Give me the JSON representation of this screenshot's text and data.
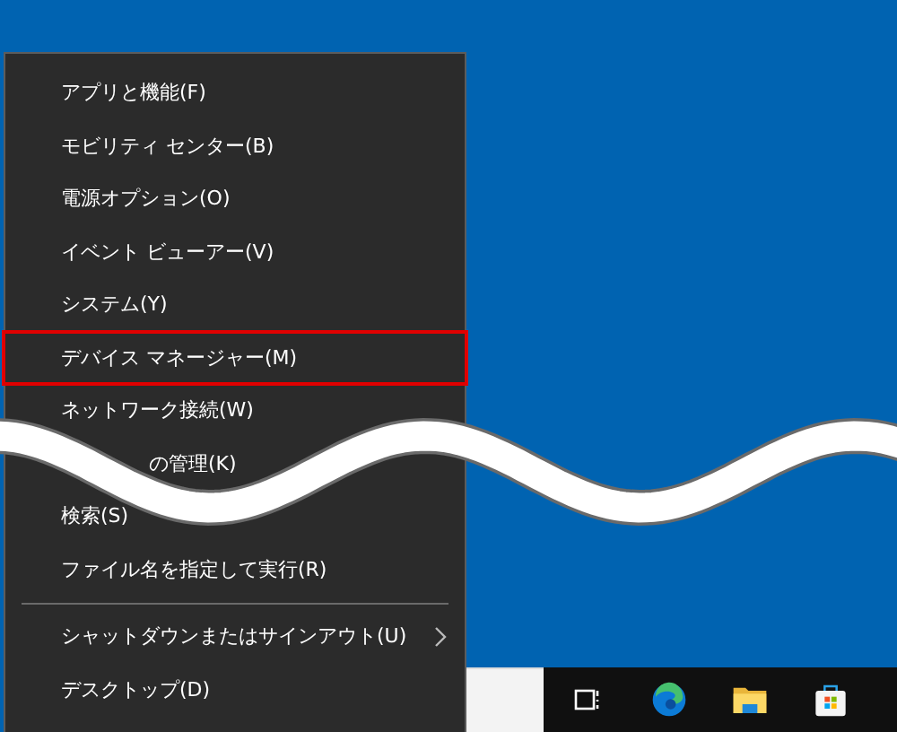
{
  "menu": {
    "items": [
      {
        "kind": "item",
        "label": "アプリと機能(F)",
        "selected": false
      },
      {
        "kind": "item",
        "label": "モビリティ センター(B)",
        "selected": false
      },
      {
        "kind": "item",
        "label": "電源オプション(O)",
        "selected": false
      },
      {
        "kind": "item",
        "label": "イベント ビューアー(V)",
        "selected": false
      },
      {
        "kind": "item",
        "label": "システム(Y)",
        "selected": false
      },
      {
        "kind": "item",
        "label": "デバイス マネージャー(M)",
        "selected": true
      },
      {
        "kind": "item",
        "label": "ネットワーク接続(W)",
        "selected": false
      },
      {
        "kind": "item",
        "label": "の管理(K)",
        "selected": false,
        "partially_hidden": true
      },
      {
        "kind": "item",
        "label": "検索(S)",
        "selected": false
      },
      {
        "kind": "item",
        "label": "ファイル名を指定して実行(R)",
        "selected": false
      },
      {
        "kind": "divider"
      },
      {
        "kind": "submenu",
        "label": "シャットダウンまたはサインアウト(U)",
        "selected": false
      },
      {
        "kind": "item",
        "label": "デスクトップ(D)",
        "selected": false
      }
    ]
  }
}
